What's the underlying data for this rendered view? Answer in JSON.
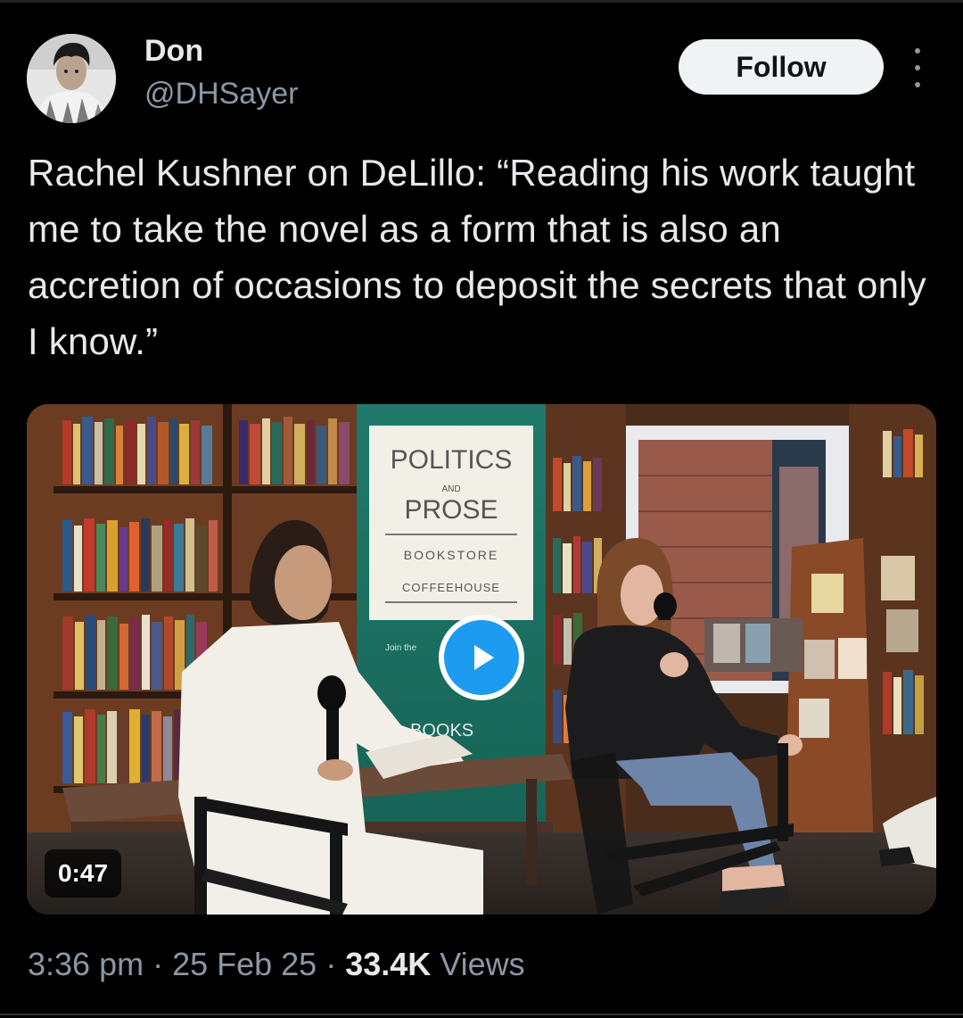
{
  "author": {
    "name": "Don",
    "handle": "@DHSayer"
  },
  "actions": {
    "follow_label": "Follow",
    "more_icon": "more-vertical-icon"
  },
  "tweet": {
    "text": "Rachel Kushner on DeLillo: “Reading his work taught me to take the novel as a form that is also an accretion of occasions to deposit the secrets that only I know.”"
  },
  "media": {
    "duration": "0:47",
    "play_icon": "play-icon",
    "banner": {
      "line1": "POLITICS",
      "line2": "AND",
      "line3": "PROSE",
      "line4": "BOOKSTORE",
      "line5": "COFFEEHOUSE",
      "line6": "Join the",
      "line7": "BOOKS"
    }
  },
  "meta": {
    "time": "3:36 pm",
    "sep1": " · ",
    "date": "25 Feb 25",
    "sep2": " · ",
    "views_count": "33.4K",
    "views_label": " Views"
  },
  "colors": {
    "background": "#000000",
    "text": "#e7e9ea",
    "secondary": "#8b98a5",
    "accent": "#1d9bf0"
  }
}
